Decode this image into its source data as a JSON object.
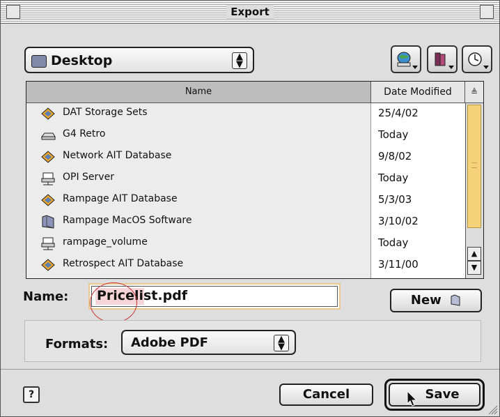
{
  "window": {
    "title": "Export"
  },
  "location": {
    "current": "Desktop",
    "popup_arrows": "⬍"
  },
  "toolbar": {
    "icons": [
      "globe-network-icon",
      "favorites-books-icon",
      "recent-clock-icon"
    ]
  },
  "file_list": {
    "columns": {
      "name": "Name",
      "date": "Date Modified",
      "sort": "≜"
    },
    "rows": [
      {
        "name": "DAT Storage Sets",
        "date": "25/4/02",
        "icon": "server-volume-icon"
      },
      {
        "name": "G4 Retro",
        "date": "Today",
        "icon": "hard-drive-icon"
      },
      {
        "name": "Network AIT Database",
        "date": "9/8/02",
        "icon": "server-volume-icon"
      },
      {
        "name": "OPI Server",
        "date": "Today",
        "icon": "network-volume-icon"
      },
      {
        "name": "Rampage AIT Database",
        "date": "5/3/03",
        "icon": "server-volume-icon"
      },
      {
        "name": "Rampage MacOS Software",
        "date": "3/10/02",
        "icon": "folder-icon"
      },
      {
        "name": "rampage_volume",
        "date": "Today",
        "icon": "network-volume-icon"
      },
      {
        "name": "Retrospect AIT Database",
        "date": "3/11/00",
        "icon": "server-volume-icon"
      }
    ],
    "scroll_arrows": {
      "up": "▲",
      "down": "▼"
    }
  },
  "name_field": {
    "label": "Name:",
    "value": "Pricelist.pdf"
  },
  "new_button": {
    "label": "New"
  },
  "formats": {
    "label": "Formats:",
    "value": "Adobe PDF",
    "popup_arrows": "⬍"
  },
  "help_button": {
    "label": "?"
  },
  "cancel_button": {
    "label": "Cancel"
  },
  "save_button": {
    "label": "Save"
  },
  "colors": {
    "accent": "#f6d27a",
    "selection": "#f7d4d8",
    "annotation_circle": "#cc3333"
  }
}
